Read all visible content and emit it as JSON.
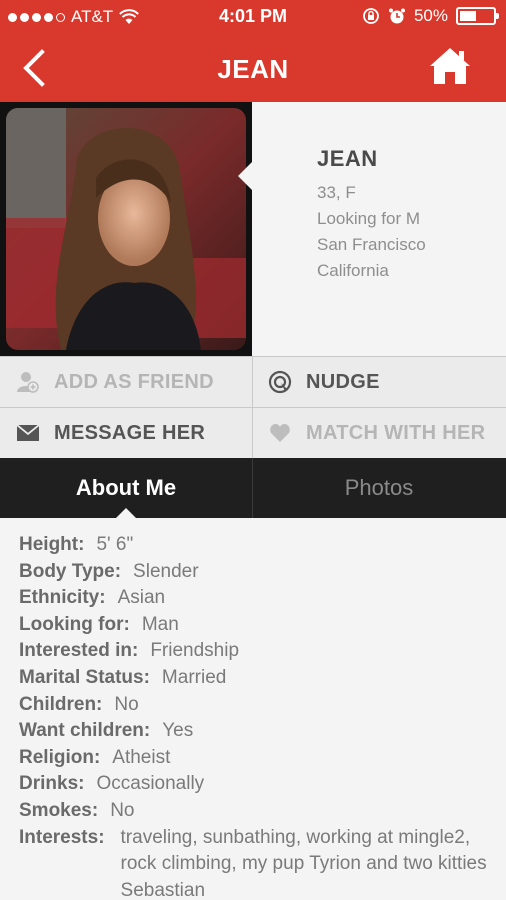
{
  "status": {
    "carrier": "AT&T",
    "time": "4:01 PM",
    "battery": "50%",
    "battery_level": 0.5
  },
  "nav": {
    "title": "JEAN"
  },
  "profile": {
    "name": "JEAN",
    "age_sex": "33, F",
    "looking": "Looking for M",
    "city": "San Francisco",
    "state": "California"
  },
  "actions": {
    "add_friend": "ADD AS FRIEND",
    "nudge": "NUDGE",
    "message": "MESSAGE HER",
    "match": "MATCH WITH HER"
  },
  "tabs": {
    "about": "About Me",
    "photos": "Photos"
  },
  "details": [
    {
      "k": "Height:",
      "v": "5' 6\""
    },
    {
      "k": "Body Type:",
      "v": "Slender"
    },
    {
      "k": "Ethnicity:",
      "v": "Asian"
    },
    {
      "k": "Looking for:",
      "v": "Man"
    },
    {
      "k": "Interested in:",
      "v": "Friendship"
    },
    {
      "k": "Marital Status:",
      "v": "Married"
    },
    {
      "k": "Children:",
      "v": "No"
    },
    {
      "k": "Want children:",
      "v": "Yes"
    },
    {
      "k": "Religion:",
      "v": "Atheist"
    },
    {
      "k": "Drinks:",
      "v": "Occasionally"
    },
    {
      "k": "Smokes:",
      "v": "No"
    },
    {
      "k": "Interests:",
      "v": "traveling, sunbathing, working at mingle2, rock climbing, my pup Tyrion and two kitties Sebastian"
    }
  ],
  "colors": {
    "brand": "#d9382c",
    "tabbar": "#1f1f1f"
  },
  "icons": {
    "back": "chevron-left-icon",
    "home": "home-icon",
    "friend": "add-user-icon",
    "nudge": "nudge-icon",
    "message": "envelope-icon",
    "match": "heart-icon"
  }
}
